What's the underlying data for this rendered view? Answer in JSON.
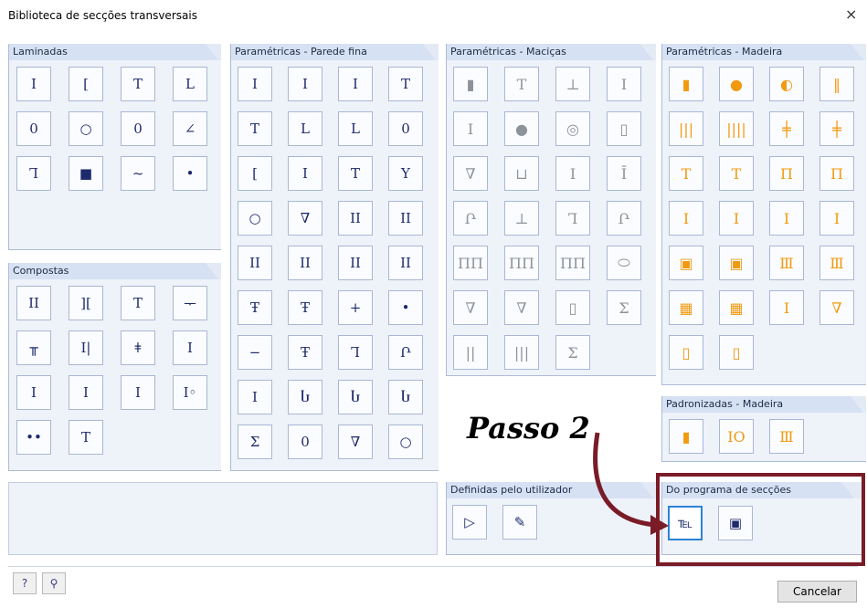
{
  "window": {
    "title": "Biblioteca de secções transversais",
    "close_glyph": "×"
  },
  "panels": {
    "laminadas": {
      "title": "Laminadas",
      "buttons": [
        "I",
        "[",
        "T",
        "L",
        "0",
        "○",
        "0",
        "∠",
        "Ꞁ",
        "■",
        "~",
        "•"
      ]
    },
    "compostas": {
      "title": "Compostas",
      "buttons": [
        "II",
        "][",
        "T",
        "ᅮ",
        "╥",
        "I|",
        "ǂ",
        "I",
        "Ⅰ",
        "Ⅰ",
        "Ⅰ",
        "I◦",
        "••",
        "T"
      ]
    },
    "param_parede": {
      "title": "Paramétricas - Parede fina",
      "buttons": [
        "I",
        "I",
        "I",
        "T",
        "T",
        "L",
        "L",
        "0",
        "[",
        "I",
        "T",
        "Y",
        "○",
        "∇",
        "II",
        "II",
        "ΙΙ",
        "ΙΙ",
        "ΙΙ",
        "ΙΙ",
        "Ŧ",
        "Ŧ",
        "+",
        "•",
        "−",
        "Ŧ",
        "Ꞁ",
        "Ր",
        "I",
        "Ⴑ",
        "Ⴑ",
        "Ⴑ",
        "Σ",
        "0",
        "∇",
        "○"
      ]
    },
    "param_macicas": {
      "title": "Paramétricas - Maciças",
      "buttons": [
        "▮",
        "T",
        "⊥",
        "I",
        "I",
        "●",
        "◎",
        "▯",
        "∇",
        "⊔",
        "I",
        "Ī",
        "Ր",
        "⊥",
        "Ꞁ",
        "Ր",
        "ΠΠ",
        "ΠΠ",
        "ΠΠ",
        "⬭",
        "∇",
        "∇",
        "▯",
        "Σ",
        "||",
        "|||",
        "Σ"
      ]
    },
    "param_madeira": {
      "title": "Paramétricas - Madeira",
      "buttons": [
        "▮",
        "●",
        "◐",
        "‖",
        "|||",
        "||||",
        "╪",
        "╪",
        "T",
        "T",
        "Π",
        "Π",
        "I",
        "I",
        "I",
        "I",
        "▣",
        "▣",
        "Ⅲ",
        "Ⅲ",
        "▦",
        "▦",
        "I",
        "∇",
        "▯",
        "▯"
      ]
    },
    "padronizadas": {
      "title": "Padronizadas - Madeira",
      "buttons": [
        "▮",
        "IO",
        "Ⅲ"
      ]
    },
    "definidas": {
      "title": "Definidas pelo utilizador",
      "buttons": [
        "▷",
        "✎"
      ]
    },
    "programa": {
      "title": "Do programa de secções",
      "buttons": [
        "℡",
        "▣"
      ]
    }
  },
  "annotation": {
    "text": "Passo 2",
    "color": "#7a1c28"
  },
  "footer": {
    "help_icon": "?",
    "search_icon": "⚲",
    "cancel_label": "Cancelar"
  },
  "colors": {
    "panel_bg": "#eef2f9",
    "header_bg": "#d6e1f3",
    "orange": "#f19a10",
    "gray": "#8d939b",
    "highlight": "#7a1c28"
  }
}
